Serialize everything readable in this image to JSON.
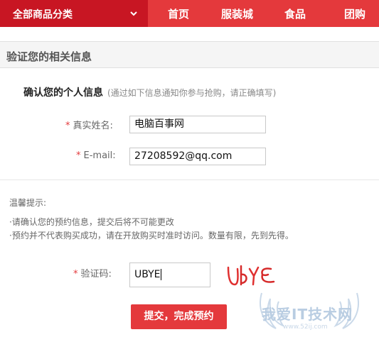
{
  "nav": {
    "category_label": "全部商品分类",
    "links": [
      "首页",
      "服装城",
      "食品",
      "团购"
    ]
  },
  "section": {
    "title": "验证您的相关信息"
  },
  "personal": {
    "title": "确认您的个人信息",
    "note": "(通过如下信息通知你参与抢购，请正确填写)"
  },
  "form": {
    "star": "*",
    "name_label": "真实姓名:",
    "name_value": "电脑百事网",
    "email_label": "E-mail:",
    "email_value": "27208592@qq.com",
    "code_label": "验证码:",
    "code_value": "UBYE"
  },
  "tips": {
    "title": "温馨提示:",
    "lines": [
      "·请确认您的预约信息，提交后将不可能更改",
      "·预约并不代表购买成功，请在开放购买时准时访问。数量有限，先到先得。"
    ]
  },
  "captcha_text": "UBYE",
  "submit_label": "提交，完成预约",
  "watermark": {
    "text": "我爱IT技术网",
    "sub": "www.52ij.com"
  },
  "colors": {
    "brand_red": "#e4393c",
    "dark_red": "#c81623"
  }
}
